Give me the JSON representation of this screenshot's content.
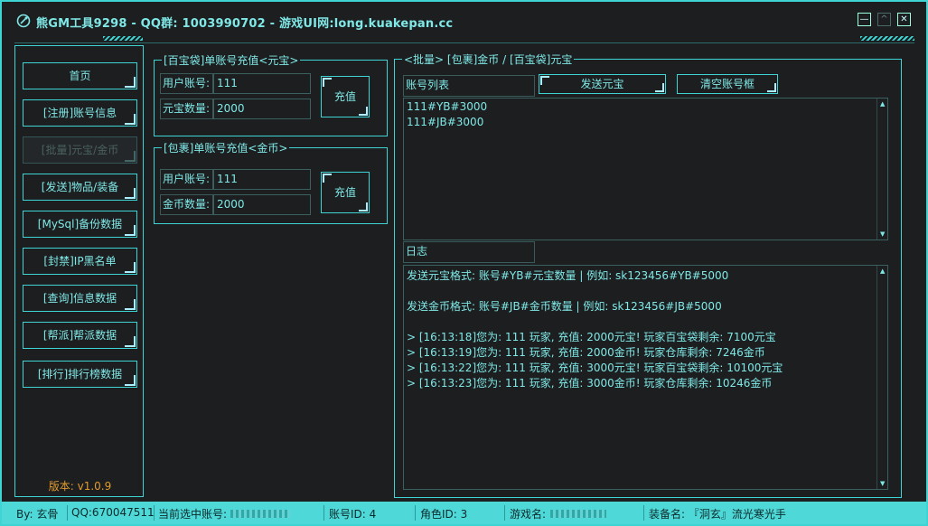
{
  "window": {
    "title": "熊GM工具9298 - QQ群: 1003990702 - 游戏UI网:long.kuakepan.cc",
    "min": "—",
    "max": "^",
    "close": "✕"
  },
  "nav": {
    "items": [
      "首页",
      "[注册]账号信息",
      "[批量]元宝/金币",
      "[发送]物品/装备",
      "[MySql]备份数据",
      "[封禁]IP黑名单",
      "[查询]信息数据",
      "[帮派]帮派数据",
      "[排行]排行榜数据"
    ],
    "version": "版本:  v1.0.9"
  },
  "yb_group": {
    "title": "[百宝袋]单账号充值<元宝>",
    "user_label": "用户账号:",
    "user_value": "111",
    "amount_label": "元宝数量:",
    "amount_value": "2000",
    "button": "充值"
  },
  "jb_group": {
    "title": "[包裹]单账号充值<金币>",
    "user_label": "用户账号:",
    "user_value": "111",
    "amount_label": "金币数量:",
    "amount_value": "2000",
    "button": "充值"
  },
  "batch": {
    "title": "<批量> [包裹]金币 / [百宝袋]元宝",
    "list_label": "账号列表",
    "send_button": "发送元宝",
    "clear_button": "清空账号框",
    "accounts": [
      "111#YB#3000",
      "111#JB#3000"
    ],
    "log_label": "日志",
    "log_lines": [
      "发送元宝格式: 账号#YB#元宝数量 | 例如: sk123456#YB#5000",
      "",
      "发送金币格式: 账号#JB#金币数量 | 例如: sk123456#JB#5000",
      "",
      "> [16:13:18]您为: 111 玩家, 充值: 2000元宝! 玩家百宝袋剩余: 7100元宝",
      "> [16:13:19]您为: 111 玩家, 充值: 2000金币! 玩家仓库剩余: 7246金币",
      "> [16:13:22]您为: 111 玩家, 充值: 3000元宝! 玩家百宝袋剩余: 10100元宝",
      "> [16:13:23]您为: 111 玩家, 充值: 3000金币! 玩家仓库剩余: 10246金币"
    ]
  },
  "status": {
    "by": "By:  玄骨",
    "qq": "QQ:670047511",
    "current_label": "当前选中账号:",
    "account_id": "账号ID:  4",
    "role_id": "角色ID:  3",
    "game_name_label": "游戏名:",
    "equip": "装备名:  『洞玄』流光寒光手"
  },
  "colors": {
    "accent": "#3fd4d4",
    "text": "#7fe8e6",
    "bg": "#1c1e20",
    "version": "#e09a2c",
    "status_bg": "#4fd8d8"
  }
}
